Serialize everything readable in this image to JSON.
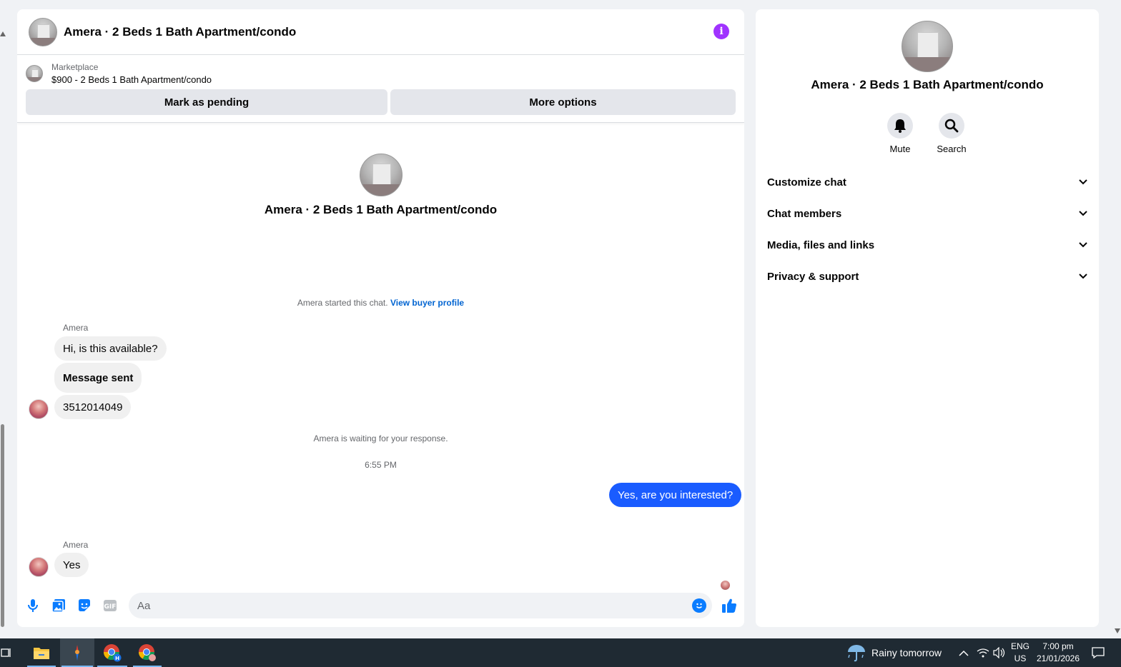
{
  "header": {
    "title": "Amera · 2 Beds 1 Bath Apartment/condo",
    "info_icon_color": "#a033ff"
  },
  "listing": {
    "label": "Marketplace",
    "price_title": "$900 - 2 Beds 1 Bath Apartment/condo",
    "mark_pending_label": "Mark as pending",
    "more_options_label": "More options"
  },
  "conversation": {
    "intro_title": "Amera · 2 Beds 1 Bath Apartment/condo",
    "started_text": "Amera started this chat.",
    "buyer_profile_link": "View buyer profile",
    "sender_name_1": "Amera",
    "message_1": "Hi, is this available?",
    "message_2": "Message sent",
    "message_3": "3512014049",
    "waiting_text": "Amera is waiting for your response.",
    "timestamp": "6:55 PM",
    "outgoing_message": "Yes, are you interested?",
    "sender_name_2": "Amera",
    "message_4": "Yes"
  },
  "composer": {
    "placeholder": "Aa",
    "icons": [
      "microphone-icon",
      "photo-icon",
      "sticker-icon",
      "gif-icon",
      "emoji-icon",
      "thumbs-up-icon"
    ],
    "accent_color": "#0a7cff"
  },
  "details_panel": {
    "title": "Amera · 2 Beds 1 Bath Apartment/condo",
    "mute_label": "Mute",
    "search_label": "Search",
    "sections": [
      {
        "label": "Customize chat"
      },
      {
        "label": "Chat members"
      },
      {
        "label": "Media, files and links"
      },
      {
        "label": "Privacy & support"
      }
    ]
  },
  "taskbar": {
    "weather": "Rainy tomorrow",
    "language": "ENG",
    "region": "US",
    "time": "7:00 pm",
    "date": "21/01/2026"
  }
}
